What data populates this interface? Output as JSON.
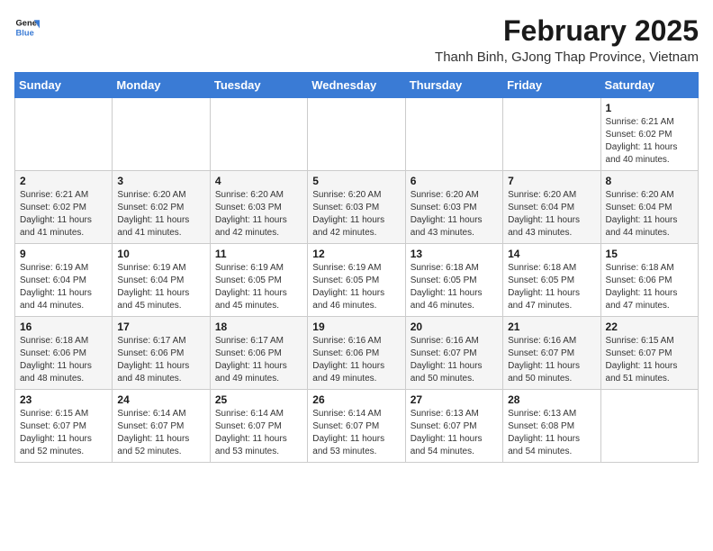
{
  "logo": {
    "line1": "General",
    "line2": "Blue"
  },
  "title": "February 2025",
  "subtitle": "Thanh Binh, GJong Thap Province, Vietnam",
  "weekdays": [
    "Sunday",
    "Monday",
    "Tuesday",
    "Wednesday",
    "Thursday",
    "Friday",
    "Saturday"
  ],
  "weeks": [
    [
      {
        "day": "",
        "info": ""
      },
      {
        "day": "",
        "info": ""
      },
      {
        "day": "",
        "info": ""
      },
      {
        "day": "",
        "info": ""
      },
      {
        "day": "",
        "info": ""
      },
      {
        "day": "",
        "info": ""
      },
      {
        "day": "1",
        "info": "Sunrise: 6:21 AM\nSunset: 6:02 PM\nDaylight: 11 hours and 40 minutes."
      }
    ],
    [
      {
        "day": "2",
        "info": "Sunrise: 6:21 AM\nSunset: 6:02 PM\nDaylight: 11 hours and 41 minutes."
      },
      {
        "day": "3",
        "info": "Sunrise: 6:20 AM\nSunset: 6:02 PM\nDaylight: 11 hours and 41 minutes."
      },
      {
        "day": "4",
        "info": "Sunrise: 6:20 AM\nSunset: 6:03 PM\nDaylight: 11 hours and 42 minutes."
      },
      {
        "day": "5",
        "info": "Sunrise: 6:20 AM\nSunset: 6:03 PM\nDaylight: 11 hours and 42 minutes."
      },
      {
        "day": "6",
        "info": "Sunrise: 6:20 AM\nSunset: 6:03 PM\nDaylight: 11 hours and 43 minutes."
      },
      {
        "day": "7",
        "info": "Sunrise: 6:20 AM\nSunset: 6:04 PM\nDaylight: 11 hours and 43 minutes."
      },
      {
        "day": "8",
        "info": "Sunrise: 6:20 AM\nSunset: 6:04 PM\nDaylight: 11 hours and 44 minutes."
      }
    ],
    [
      {
        "day": "9",
        "info": "Sunrise: 6:19 AM\nSunset: 6:04 PM\nDaylight: 11 hours and 44 minutes."
      },
      {
        "day": "10",
        "info": "Sunrise: 6:19 AM\nSunset: 6:04 PM\nDaylight: 11 hours and 45 minutes."
      },
      {
        "day": "11",
        "info": "Sunrise: 6:19 AM\nSunset: 6:05 PM\nDaylight: 11 hours and 45 minutes."
      },
      {
        "day": "12",
        "info": "Sunrise: 6:19 AM\nSunset: 6:05 PM\nDaylight: 11 hours and 46 minutes."
      },
      {
        "day": "13",
        "info": "Sunrise: 6:18 AM\nSunset: 6:05 PM\nDaylight: 11 hours and 46 minutes."
      },
      {
        "day": "14",
        "info": "Sunrise: 6:18 AM\nSunset: 6:05 PM\nDaylight: 11 hours and 47 minutes."
      },
      {
        "day": "15",
        "info": "Sunrise: 6:18 AM\nSunset: 6:06 PM\nDaylight: 11 hours and 47 minutes."
      }
    ],
    [
      {
        "day": "16",
        "info": "Sunrise: 6:18 AM\nSunset: 6:06 PM\nDaylight: 11 hours and 48 minutes."
      },
      {
        "day": "17",
        "info": "Sunrise: 6:17 AM\nSunset: 6:06 PM\nDaylight: 11 hours and 48 minutes."
      },
      {
        "day": "18",
        "info": "Sunrise: 6:17 AM\nSunset: 6:06 PM\nDaylight: 11 hours and 49 minutes."
      },
      {
        "day": "19",
        "info": "Sunrise: 6:16 AM\nSunset: 6:06 PM\nDaylight: 11 hours and 49 minutes."
      },
      {
        "day": "20",
        "info": "Sunrise: 6:16 AM\nSunset: 6:07 PM\nDaylight: 11 hours and 50 minutes."
      },
      {
        "day": "21",
        "info": "Sunrise: 6:16 AM\nSunset: 6:07 PM\nDaylight: 11 hours and 50 minutes."
      },
      {
        "day": "22",
        "info": "Sunrise: 6:15 AM\nSunset: 6:07 PM\nDaylight: 11 hours and 51 minutes."
      }
    ],
    [
      {
        "day": "23",
        "info": "Sunrise: 6:15 AM\nSunset: 6:07 PM\nDaylight: 11 hours and 52 minutes."
      },
      {
        "day": "24",
        "info": "Sunrise: 6:14 AM\nSunset: 6:07 PM\nDaylight: 11 hours and 52 minutes."
      },
      {
        "day": "25",
        "info": "Sunrise: 6:14 AM\nSunset: 6:07 PM\nDaylight: 11 hours and 53 minutes."
      },
      {
        "day": "26",
        "info": "Sunrise: 6:14 AM\nSunset: 6:07 PM\nDaylight: 11 hours and 53 minutes."
      },
      {
        "day": "27",
        "info": "Sunrise: 6:13 AM\nSunset: 6:07 PM\nDaylight: 11 hours and 54 minutes."
      },
      {
        "day": "28",
        "info": "Sunrise: 6:13 AM\nSunset: 6:08 PM\nDaylight: 11 hours and 54 minutes."
      },
      {
        "day": "",
        "info": ""
      }
    ]
  ]
}
